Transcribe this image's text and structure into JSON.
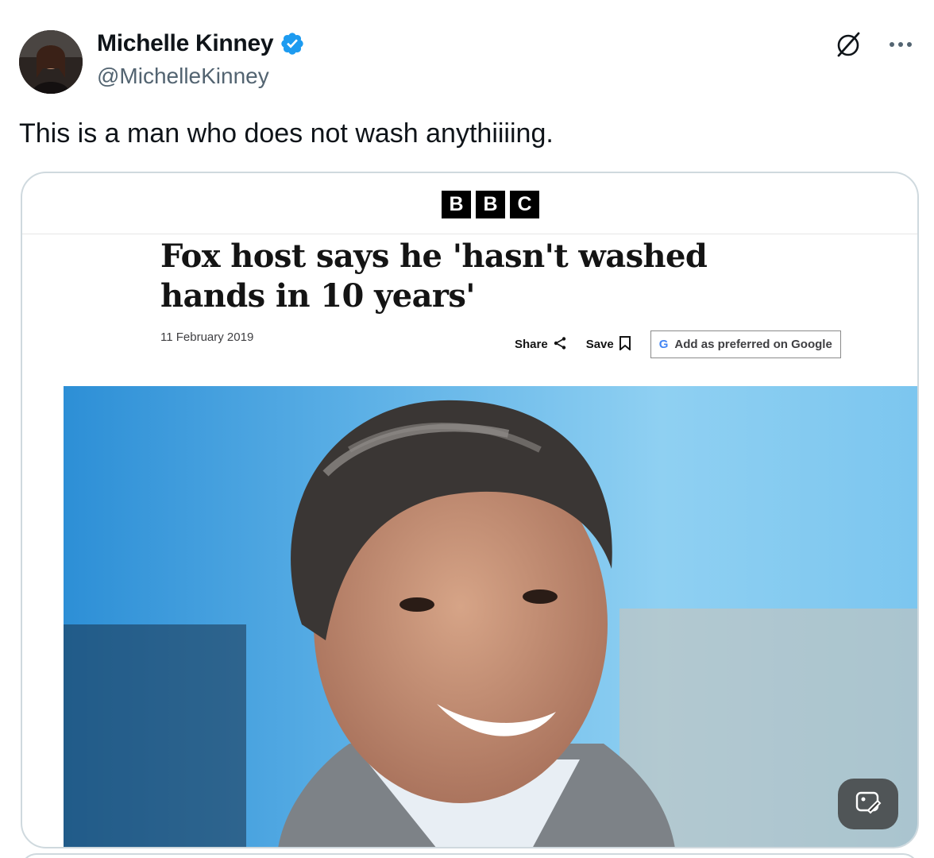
{
  "author": {
    "display_name": "Michelle Kinney",
    "handle": "@MichelleKinney",
    "verified_color": "#1d9bf0"
  },
  "tweet": {
    "text": "This is a man who does not wash anythiiiing."
  },
  "icons": {
    "grok": "grok-icon",
    "more": "more-icon",
    "verified": "verified-badge-icon",
    "alt_image": "image-edit-icon"
  },
  "article": {
    "publisher_logo": [
      "B",
      "B",
      "C"
    ],
    "headline": "Fox host says he 'hasn't washed hands in 10 years'",
    "date": "11 February 2019",
    "share_label": "Share",
    "save_label": "Save",
    "google_pref_label": "Add as preferred on Google"
  },
  "colors": {
    "text_primary": "#0f1419",
    "text_secondary": "#536471",
    "card_border": "#cfd9de",
    "verified_blue": "#1d9bf0"
  }
}
